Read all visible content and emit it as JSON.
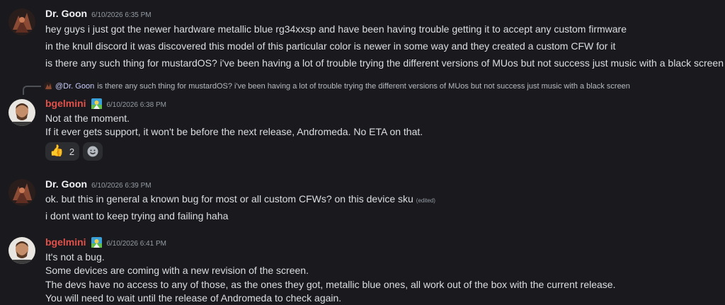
{
  "messages": [
    {
      "author": "Dr. Goon",
      "timestamp": "6/10/2026 6:35 PM",
      "lines": [
        "hey guys i just got the newer hardware metallic blue rg34xxsp and have been having trouble getting it to accept any custom firmware",
        "in the knull discord it was discovered this model of this particular color is newer in some way and they created a custom CFW for it",
        "is there any such thing for mustardOS? i've been having a lot of trouble trying the different versions of MUos but not success just music with a black screen"
      ]
    },
    {
      "reply": {
        "mention": "@Dr. Goon",
        "text": "is there any such thing for mustardOS? i've been having a lot of trouble trying the different versions of MUos but not success just music with a black screen"
      },
      "author": "bgelmini",
      "timestamp": "6/10/2026 6:38 PM",
      "lines": [
        "Not at the moment.",
        "If it ever gets support, it won't be before the next release, Andromeda. No ETA on that."
      ],
      "reaction": {
        "emoji": "👍",
        "count": "2"
      }
    },
    {
      "author": "Dr. Goon",
      "timestamp": "6/10/2026 6:39 PM",
      "lines": [
        "ok. but this in general a known bug for most or all custom CFWs? on this device sku",
        "i dont want to keep trying and failing haha"
      ],
      "edited_label": "(edited)"
    },
    {
      "author": "bgelmini",
      "timestamp": "6/10/2026 6:41 PM",
      "lines": [
        "It's not a bug.",
        "Some devices are coming with a new revision of the screen.",
        "The devs have no access to any of those, as the ones they got, metallic blue ones, all work out of the box with the current release.",
        "You will need to wait until the release of Andromeda to check again."
      ]
    }
  ],
  "colors": {
    "background": "#1a1a1e",
    "username_bgelmini": "#e2504a",
    "mention": "#c9cdfb"
  },
  "icons": [
    "goon-avatar",
    "bgelmini-avatar",
    "role-badge-icon",
    "thumbs-up-emoji",
    "add-reaction-icon"
  ]
}
